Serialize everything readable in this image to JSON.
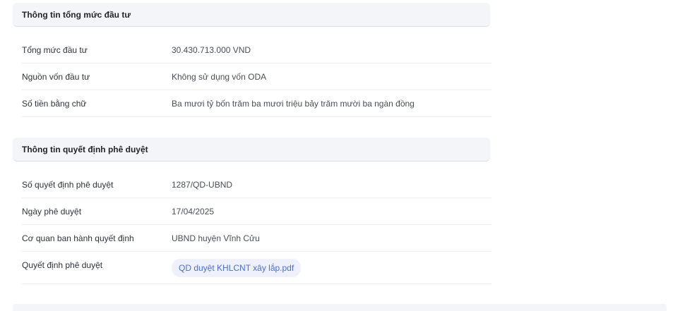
{
  "investment_section": {
    "title": "Thông tin tổng mức đầu tư",
    "rows": [
      {
        "label": "Tổng mức đầu tư",
        "value": "30.430.713.000 VND"
      },
      {
        "label": "Nguồn vốn đầu tư",
        "value": "Không sử dụng vốn ODA"
      },
      {
        "label": "Số tiền bằng chữ",
        "value": "Ba mươi tỷ bốn trăm ba mươi triệu bảy trăm mười ba ngàn đồng"
      }
    ]
  },
  "approval_section": {
    "title": "Thông tin quyết định phê duyệt",
    "rows": [
      {
        "label": "Số quyết định phê duyệt",
        "value": "1287/QD-UBND"
      },
      {
        "label": "Ngày phê duyệt",
        "value": "17/04/2025"
      },
      {
        "label": "Cơ quan ban hành quyết định",
        "value": "UBND huyện Vĩnh Cửu"
      },
      {
        "label": "Quyết định phê duyệt",
        "file_name": "QD duyệt KHLCNT xây lắp.pdf"
      }
    ]
  },
  "colors": {
    "header_bg": "#f3f5f9",
    "link": "#4a6fd1",
    "chip_bg": "#eef1fb",
    "divider": "#eceef2"
  }
}
